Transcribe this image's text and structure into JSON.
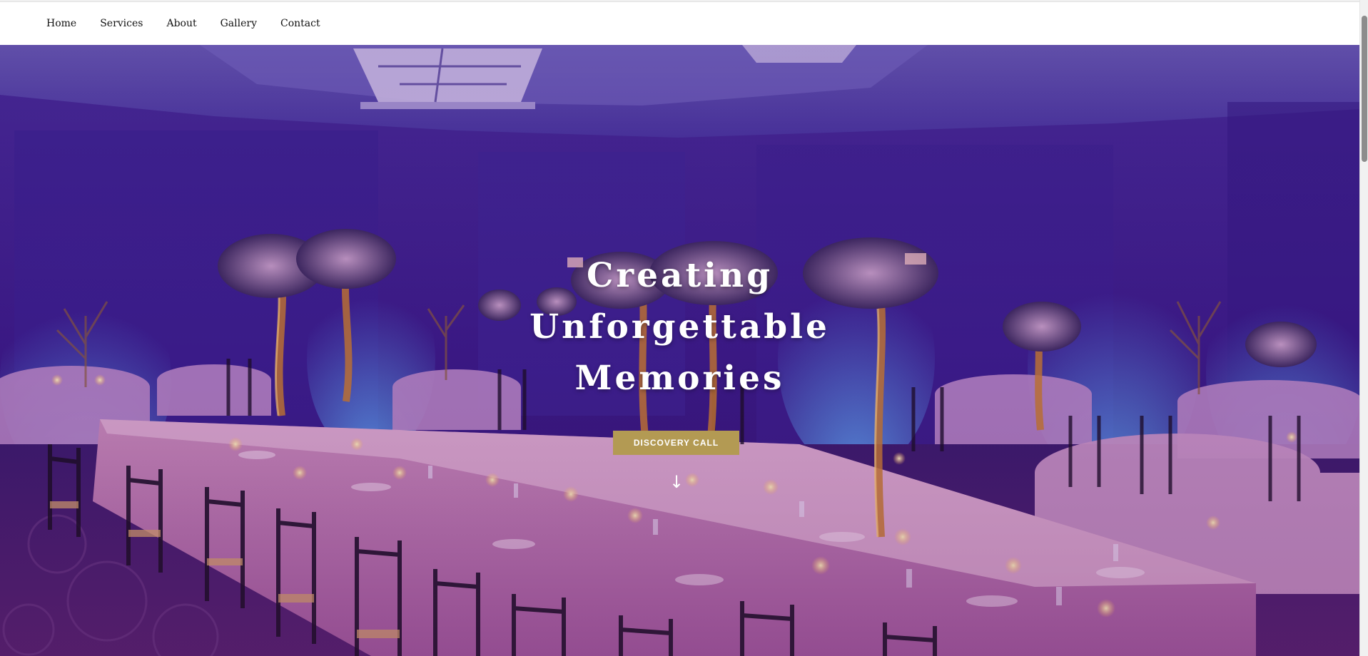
{
  "nav": {
    "items": [
      {
        "label": "Home"
      },
      {
        "label": "Services"
      },
      {
        "label": "About"
      },
      {
        "label": "Gallery"
      },
      {
        "label": "Contact"
      }
    ]
  },
  "hero": {
    "title_lines": [
      "Creating",
      "Unforgettable",
      "Memories"
    ],
    "cta_label": "DISCOVERY CALL",
    "scroll_icon": "arrow-down-icon",
    "background_image": "banquet-hall-photo"
  },
  "colors": {
    "cta_background": "#b39a53",
    "hero_tint": "#3a1b7a",
    "nav_text": "#111111"
  }
}
